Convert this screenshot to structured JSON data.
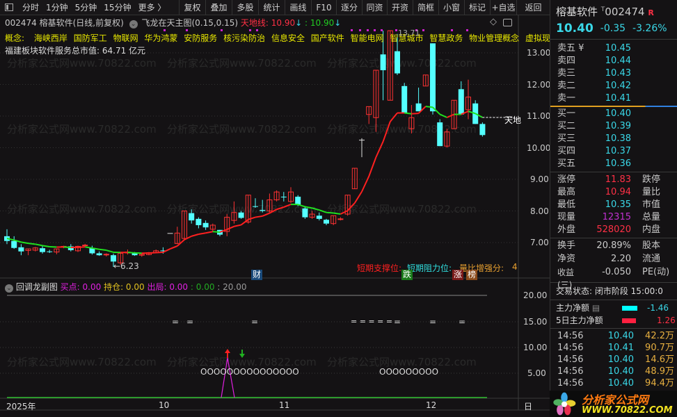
{
  "toolbar": {
    "periods": [
      "分时",
      "1分钟",
      "5分钟",
      "15分钟",
      "更多 〉"
    ],
    "buttons": [
      "复权",
      "叠加",
      "多股",
      "统计",
      "画线",
      "F10",
      "逐分",
      "同资",
      "开资",
      "简框",
      "小窗",
      "标记",
      "+自选",
      "返回"
    ]
  },
  "info": {
    "symbol": "002474 榕基软件(日线,前复权)",
    "indicator": "飞龙在天主图(0.15,0.15)",
    "tiandi_label": "天地线:",
    "tiandi_value1": "10.90",
    "tiandi_value2": ": 10.90",
    "concept_label": "概念:",
    "concepts": [
      "海峡西岸",
      "国防军工",
      "物联网",
      "华为鸿蒙",
      "安防服务",
      "核污染防治",
      "信息安全",
      "国产软件",
      "智能电网",
      "智慧城市",
      "智慧政务",
      "物业管理概念",
      "虚拟现实"
    ],
    "market_cap": "福建板块软件服务总市值:  64.71 亿元"
  },
  "watermark": "分析家公式网www.70822.com",
  "main_chart": {
    "high_label": "13.71",
    "low_label": "←6.23",
    "tiandi_tag": "天地",
    "support_label": "短期支撑位:",
    "resistance_label": "短期阻力位:",
    "volume_label": "量比增强分:",
    "volume_value": "4",
    "badges": [
      {
        "text": "财",
        "color": "#1a4a7a"
      },
      {
        "text": "跌",
        "color": "#1a7a1a"
      },
      {
        "text": "涨",
        "color": "#7a1a1a"
      },
      {
        "text": "榜",
        "color": "#8a4a1a"
      }
    ]
  },
  "chart_data": {
    "type": "candlestick",
    "price_ticks": [
      "13.00",
      "12.00",
      "11.00",
      "10.00",
      "9.00",
      "8.00",
      "7.00"
    ],
    "ylim": [
      6.0,
      13.8
    ],
    "up_color": "#ff3232",
    "down_color": "#54ffff",
    "candles_ohlc": [
      [
        7.2,
        7.42,
        6.95,
        7.05
      ],
      [
        7.05,
        7.2,
        6.8,
        6.83
      ],
      [
        6.85,
        6.95,
        6.6,
        6.72
      ],
      [
        6.75,
        6.8,
        6.6,
        6.8
      ],
      [
        6.76,
        6.86,
        6.72,
        6.83
      ],
      [
        6.82,
        6.9,
        6.65,
        6.7
      ],
      [
        6.72,
        6.77,
        6.67,
        6.71
      ],
      [
        6.7,
        6.8,
        6.63,
        6.8
      ],
      [
        6.85,
        6.9,
        6.82,
        6.88
      ],
      [
        6.88,
        6.95,
        6.72,
        6.76
      ],
      [
        6.74,
        6.9,
        6.7,
        6.88
      ],
      [
        6.9,
        6.96,
        6.88,
        6.92
      ],
      [
        6.83,
        6.9,
        6.62,
        6.66
      ],
      [
        6.66,
        6.72,
        6.58,
        6.6
      ],
      [
        6.62,
        6.66,
        6.56,
        6.63
      ],
      [
        6.6,
        6.65,
        6.23,
        6.4
      ],
      [
        6.36,
        6.7,
        6.3,
        6.66
      ],
      [
        6.67,
        6.78,
        6.62,
        6.7
      ],
      [
        6.66,
        6.7,
        6.58,
        6.6
      ],
      [
        6.6,
        6.65,
        6.55,
        6.63
      ],
      [
        6.62,
        6.7,
        6.6,
        6.68
      ],
      [
        6.68,
        6.78,
        6.66,
        6.74
      ],
      [
        6.75,
        6.85,
        6.65,
        6.74
      ],
      [
        7.3,
        7.3,
        7.3,
        7.3
      ],
      [
        6.97,
        7.5,
        6.95,
        7.3
      ],
      [
        7.13,
        8.0,
        7.1,
        8.0
      ],
      [
        7.93,
        8.05,
        7.6,
        7.7
      ],
      [
        7.75,
        7.8,
        7.45,
        7.55
      ],
      [
        7.62,
        7.7,
        7.4,
        7.48
      ],
      [
        7.42,
        7.6,
        7.35,
        7.55
      ],
      [
        7.4,
        7.4,
        7.2,
        7.25
      ],
      [
        7.35,
        7.9,
        7.2,
        7.8
      ],
      [
        7.7,
        8.3,
        7.6,
        7.95
      ],
      [
        7.95,
        8.0,
        7.75,
        7.78
      ],
      [
        7.65,
        8.5,
        7.6,
        8.5
      ],
      [
        8.15,
        8.4,
        8.1,
        8.13
      ],
      [
        8.03,
        8.35,
        7.95,
        8.0
      ],
      [
        8.0,
        8.55,
        7.95,
        8.35
      ],
      [
        8.35,
        8.65,
        8.3,
        8.6
      ],
      [
        8.45,
        8.6,
        8.3,
        8.44
      ],
      [
        8.3,
        8.75,
        8.25,
        8.6
      ],
      [
        8.45,
        8.5,
        8.15,
        8.2
      ],
      [
        8.08,
        8.15,
        7.75,
        7.8
      ],
      [
        7.8,
        8.0,
        7.75,
        7.9
      ],
      [
        7.85,
        7.95,
        7.7,
        7.75
      ],
      [
        7.72,
        7.75,
        7.55,
        7.6
      ],
      [
        7.6,
        7.85,
        7.55,
        7.85
      ],
      [
        7.73,
        7.8,
        7.7,
        7.75
      ],
      [
        7.9,
        8.5,
        7.85,
        8.5
      ],
      [
        8.7,
        9.35,
        8.7,
        9.35
      ],
      [
        10.25,
        10.3,
        9.7,
        10.25
      ],
      [
        11.05,
        11.3,
        10.75,
        11.3
      ],
      [
        10.95,
        12.45,
        10.5,
        12.45
      ],
      [
        12.95,
        13.7,
        11.5,
        12.45
      ],
      [
        11.5,
        13.71,
        11.5,
        13.7
      ],
      [
        13.05,
        13.6,
        12.3,
        12.35
      ],
      [
        11.95,
        12.05,
        11.1,
        11.1
      ],
      [
        10.6,
        11.35,
        10.45,
        10.95
      ],
      [
        11.4,
        11.9,
        11.15,
        11.15
      ],
      [
        11.95,
        12.3,
        11.95,
        12.3
      ],
      [
        13.3,
        13.3,
        11.05,
        11.15
      ],
      [
        10.8,
        10.9,
        10.05,
        10.05
      ],
      [
        10.05,
        10.6,
        10.0,
        10.5
      ],
      [
        10.6,
        11.5,
        10.6,
        11.5
      ],
      [
        11.85,
        12.1,
        11.05,
        11.05
      ],
      [
        11.2,
        12.15,
        10.9,
        11.6
      ],
      [
        11.4,
        11.5,
        10.75,
        10.75
      ],
      [
        10.75,
        10.8,
        10.35,
        10.4
      ]
    ]
  },
  "sub_chart": {
    "title": "回调龙副图",
    "buy_label": "买点: 0.00",
    "hold_label": "持仓: 0.00",
    "exit_label": "出局: 0.00",
    "v1": ": 0.00",
    "v2": ": 20.00",
    "ticks": [
      "20.00",
      "15.00",
      "10.00",
      "5.00"
    ],
    "circles1": "OOOOOOOOOOOOOOO",
    "circles2": "OOOOOOOOO",
    "eq": "=",
    "eq5": "= = = = ="
  },
  "dates": [
    "2025年",
    "10",
    "11",
    "12",
    "日"
  ],
  "right": {
    "name": "榕基软件",
    "t": "T",
    "code": "002474",
    "r": "R",
    "price": "10.40",
    "change": "-0.35",
    "pct": "-3.26%",
    "asks": [
      [
        "卖五 ¥",
        "10.45"
      ],
      [
        "卖四",
        "10.44"
      ],
      [
        "卖三",
        "10.43"
      ],
      [
        "卖二",
        "10.42"
      ],
      [
        "卖一",
        "10.41"
      ]
    ],
    "bids": [
      [
        "买一",
        "10.40"
      ],
      [
        "买二",
        "10.39"
      ],
      [
        "买三",
        "10.38"
      ],
      [
        "买四",
        "10.37"
      ],
      [
        "买五",
        "10.36"
      ]
    ],
    "stats": [
      [
        "涨停",
        "11.83",
        "跌停"
      ],
      [
        "最高",
        "10.94",
        "量比"
      ],
      [
        "最低",
        "10.35",
        "市值"
      ],
      [
        "现量",
        "12315",
        "总量"
      ],
      [
        "外盘",
        "528020",
        "内盘"
      ]
    ],
    "stats2": [
      [
        "换手",
        "20.89%",
        "股本"
      ],
      [
        "净资",
        "2.20",
        "流通"
      ],
      [
        "收益(三)",
        "-0.050",
        "PE(动)"
      ]
    ],
    "trade_state": "交易状态: 闭市阶段 15:00:0",
    "main_net_label": "主力净额",
    "main_net": "-1.46",
    "main5_label": "5日主力净额",
    "main5": "1.26",
    "trades": [
      [
        "14:56",
        "10.40",
        "42.2万"
      ],
      [
        "14:56",
        "10.41",
        "90.7万"
      ],
      [
        "14:56",
        "10.40",
        "14.6万"
      ],
      [
        "14:56",
        "10.40",
        "48.9万"
      ],
      [
        "14:56",
        "10.40",
        "94.4万"
      ]
    ],
    "logo_title": "分析家公式网",
    "logo_url": "WWW.70822.COM"
  }
}
